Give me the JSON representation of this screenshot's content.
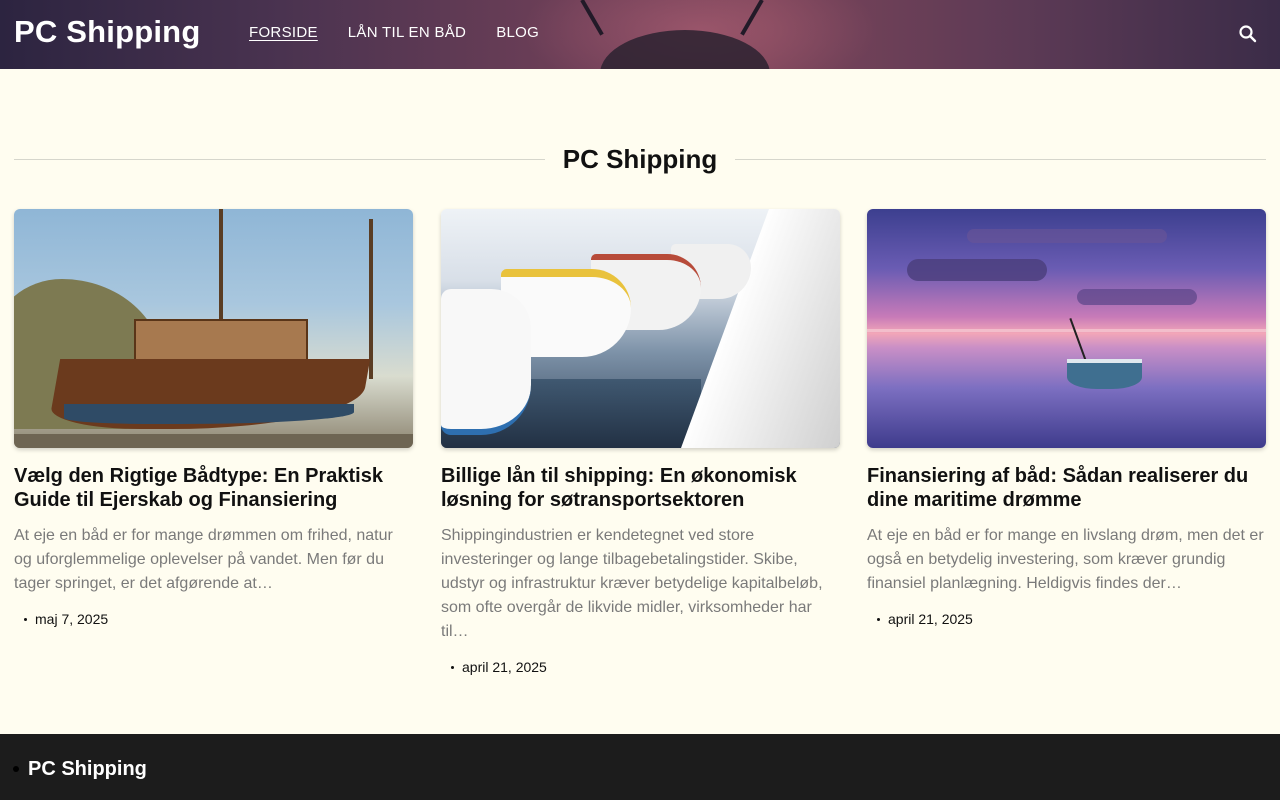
{
  "header": {
    "brand": "PC Shipping",
    "nav": [
      {
        "label": "FORSIDE",
        "active": true
      },
      {
        "label": "LÅN TIL EN BÅD",
        "active": false
      },
      {
        "label": "BLOG",
        "active": false
      }
    ],
    "search_icon": "search-icon"
  },
  "section": {
    "title": "PC Shipping"
  },
  "posts": [
    {
      "title": "Vælg den Rigtige Bådtype: En Praktisk Guide til Ejerskab og Finansiering",
      "excerpt": "At eje en båd er for mange drømmen om frihed, natur og uforglemmelige oplevelser på vandet. Men før du tager springet, er det afgørende at…",
      "date": "maj 7, 2025"
    },
    {
      "title": "Billige lån til shipping: En økonomisk løsning for søtransportsektoren",
      "excerpt": "Shippingindustrien er kendetegnet ved store investeringer og lange tilbagebetalingstider. Skibe, udstyr og infrastruktur kræver betydelige kapitalbeløb, som ofte overgår de likvide midler, virksomheder har til…",
      "date": "april 21, 2025"
    },
    {
      "title": "Finansiering af båd: Sådan realiserer du dine maritime drømme",
      "excerpt": "At eje en båd er for mange en livslang drøm, men det er også en betydelig investering, som kræver grundig finansiel planlægning. Heldigvis findes der…",
      "date": "april 21, 2025"
    }
  ],
  "footer": {
    "brand": "PC Shipping"
  },
  "colors": {
    "background": "#fffdf0",
    "footer": "#1c1c1c",
    "excerpt_text": "#7a7a7a"
  }
}
